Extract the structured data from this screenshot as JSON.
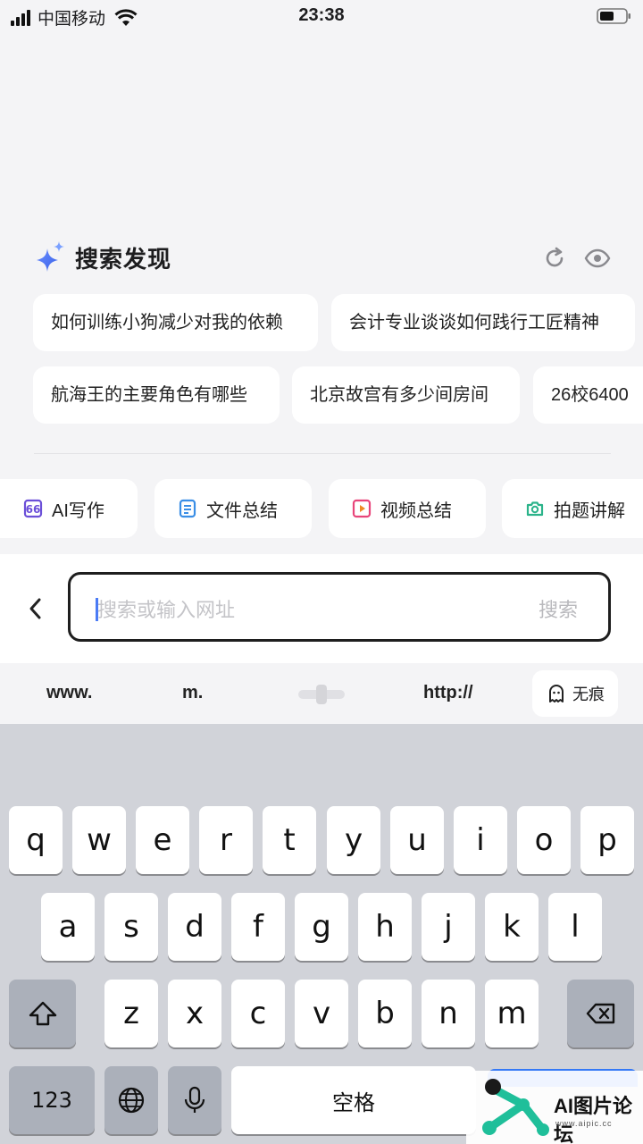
{
  "status_bar": {
    "carrier": "中国移动",
    "time": "23:38"
  },
  "discovery": {
    "title": "搜索发现",
    "suggestions_row1": [
      "如何训练小狗减少对我的依赖",
      "会计专业谈谈如何践行工匠精神"
    ],
    "suggestions_row2": [
      "航海王的主要角色有哪些",
      "北京故宫有多少间房间",
      "26校6400"
    ]
  },
  "tools": [
    {
      "label": "AI写作",
      "icon": "ai-write-icon",
      "color": "#6b4fd8"
    },
    {
      "label": "文件总结",
      "icon": "file-summary-icon",
      "color": "#3a8ee6"
    },
    {
      "label": "视频总结",
      "icon": "video-summary-icon",
      "color": "#e8457a"
    },
    {
      "label": "拍题讲解",
      "icon": "camera-icon",
      "color": "#2bb38a"
    }
  ],
  "search": {
    "placeholder": "搜索或输入网址",
    "button": "搜索"
  },
  "quick_bar": {
    "www": "www.",
    "m": "m.",
    "http": "http://",
    "incognito": "无痕"
  },
  "keyboard": {
    "row1": [
      "q",
      "w",
      "e",
      "r",
      "t",
      "y",
      "u",
      "i",
      "o",
      "p"
    ],
    "row2": [
      "a",
      "s",
      "d",
      "f",
      "g",
      "h",
      "j",
      "k",
      "l"
    ],
    "row3": [
      "z",
      "x",
      "c",
      "v",
      "b",
      "n",
      "m"
    ],
    "numbers": "123",
    "space": "空格"
  },
  "watermark": {
    "name": "AI图片论坛",
    "url": "www.aipic.cc"
  }
}
